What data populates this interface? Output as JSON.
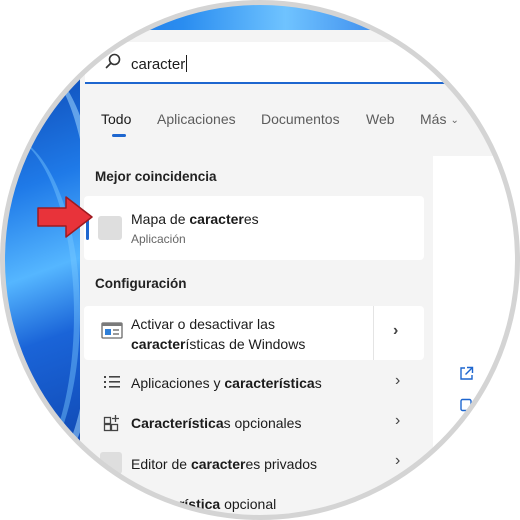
{
  "search": {
    "query": "caracter"
  },
  "tabs": [
    {
      "label": "Todo"
    },
    {
      "label": "Aplicaciones"
    },
    {
      "label": "Documentos"
    },
    {
      "label": "Web"
    },
    {
      "label": "Más"
    }
  ],
  "best_match": {
    "heading": "Mejor coincidencia",
    "title_prefix": "Mapa de ",
    "title_bold": "caracter",
    "title_suffix": "es",
    "subtitle": "Aplicación"
  },
  "settings": {
    "heading": "Configuración",
    "items": [
      {
        "line1": "Activar o desactivar las",
        "line2_bold": "caracter",
        "line2_rest": "ísticas de Windows"
      },
      {
        "prefix": "Aplicaciones y ",
        "bold": "característica",
        "suffix": "s"
      },
      {
        "prefix": "",
        "bold": "Característica",
        "suffix": "s opcionales"
      },
      {
        "prefix": "Editor de ",
        "bold": "caracter",
        "suffix": "es privados"
      },
      {
        "prefix": "Ver ",
        "bold": "característica",
        "suffix": " opcional"
      }
    ]
  },
  "colors": {
    "accent": "#1d66cf",
    "arrow": "#e8333a"
  },
  "icons": {
    "search": "search-icon",
    "windows_features": "windows-features-icon",
    "apps_list": "list-icon",
    "optional_features": "grid-plus-icon",
    "open": "external-link-icon"
  }
}
